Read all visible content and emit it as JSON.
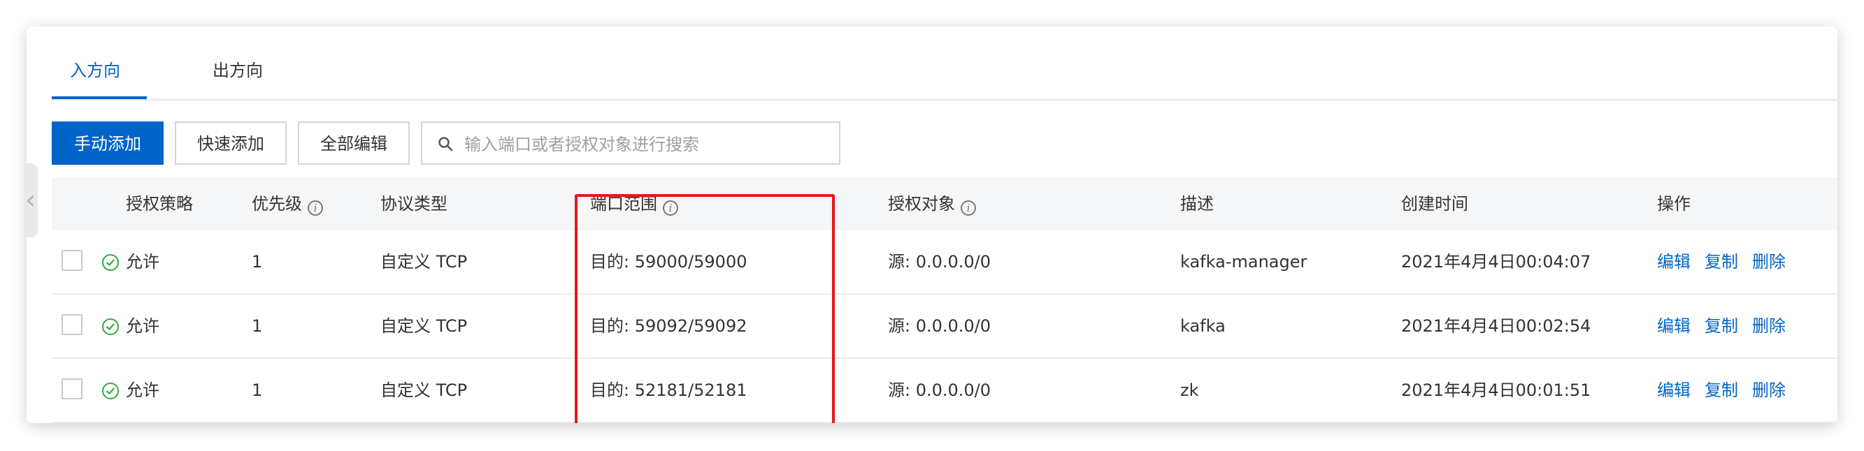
{
  "tabs": [
    {
      "label": "入方向",
      "active": true
    },
    {
      "label": "出方向",
      "active": false
    }
  ],
  "toolbar": {
    "manual_add": "手动添加",
    "quick_add": "快速添加",
    "edit_all": "全部编辑",
    "search_placeholder": "输入端口或者授权对象进行搜索"
  },
  "table": {
    "headers": {
      "policy": "授权策略",
      "priority": "优先级",
      "protocol": "协议类型",
      "port_range": "端口范围",
      "auth_object": "授权对象",
      "description": "描述",
      "created": "创建时间",
      "actions": "操作"
    },
    "rows": [
      {
        "policy": "允许",
        "priority": "1",
        "protocol": "自定义 TCP",
        "port_range": "目的: 59000/59000",
        "auth_object": "源: 0.0.0.0/0",
        "description": "kafka-manager",
        "created": "2021年4月4日00:04:07"
      },
      {
        "policy": "允许",
        "priority": "1",
        "protocol": "自定义 TCP",
        "port_range": "目的: 59092/59092",
        "auth_object": "源: 0.0.0.0/0",
        "description": "kafka",
        "created": "2021年4月4日00:02:54"
      },
      {
        "policy": "允许",
        "priority": "1",
        "protocol": "自定义 TCP",
        "port_range": "目的: 52181/52181",
        "auth_object": "源: 0.0.0.0/0",
        "description": "zk",
        "created": "2021年4月4日00:01:51"
      }
    ],
    "row_actions": {
      "edit": "编辑",
      "copy": "复制",
      "delete": "删除"
    }
  },
  "icons": {
    "search": "search-icon",
    "info": "info-icon",
    "allow": "check-circle-icon",
    "side_handle": "chevron-left-icon"
  },
  "colors": {
    "accent": "#0064c8",
    "allow_green": "#2eab3c",
    "highlight_red": "#e5191c"
  }
}
